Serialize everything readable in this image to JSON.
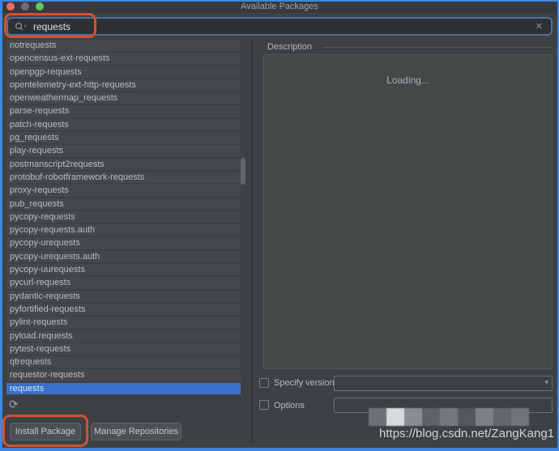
{
  "window": {
    "title": "Available Packages"
  },
  "search": {
    "value": "requests"
  },
  "package_list": {
    "items": [
      "notrequests",
      "opencensus-ext-requests",
      "openpgp-requests",
      "opentelemetry-ext-http-requests",
      "openweathermap_requests",
      "parse-requests",
      "patch-requests",
      "pg_requests",
      "play-requests",
      "postmanscript2requests",
      "protobuf-robotframework-requests",
      "proxy-requests",
      "pub_requests",
      "pycopy-requests",
      "pycopy-requests.auth",
      "pycopy-urequests",
      "pycopy-urequests.auth",
      "pycopy-uurequests",
      "pycurl-requests",
      "pydantic-requests",
      "pyfortified-requests",
      "pylint-requests",
      "pyload.requests",
      "pytest-requests",
      "qtrequests",
      "requestor-requests",
      "requests"
    ],
    "selected": "requests"
  },
  "description": {
    "header": "Description",
    "loading_text": "Loading..."
  },
  "install_options": {
    "specify_version_label": "Specify version",
    "specify_version_checked": false,
    "specify_version_value": "",
    "options_label": "Options",
    "options_checked": false,
    "options_value": ""
  },
  "buttons": {
    "install": "Install Package",
    "manage": "Manage Repositories"
  },
  "watermark": {
    "text": "https://blog.csdn.net/ZangKang1",
    "mosaic_colors": [
      "#6e7174",
      "#d8d9da",
      "#8b8e91",
      "#5f6366",
      "#75787b",
      "#55585b",
      "#7e8184",
      "#63666a",
      "#70747a"
    ]
  },
  "icons": {
    "clear": "✕",
    "refresh": "⟳",
    "combo_caret": "▾"
  },
  "colors": {
    "selection": "#3a70c8",
    "annotation": "#d4512e",
    "frame": "#3f87e0",
    "traffic_close": "#ed6a5e",
    "traffic_minimize": "#6b7075",
    "traffic_zoom": "#64c554"
  }
}
